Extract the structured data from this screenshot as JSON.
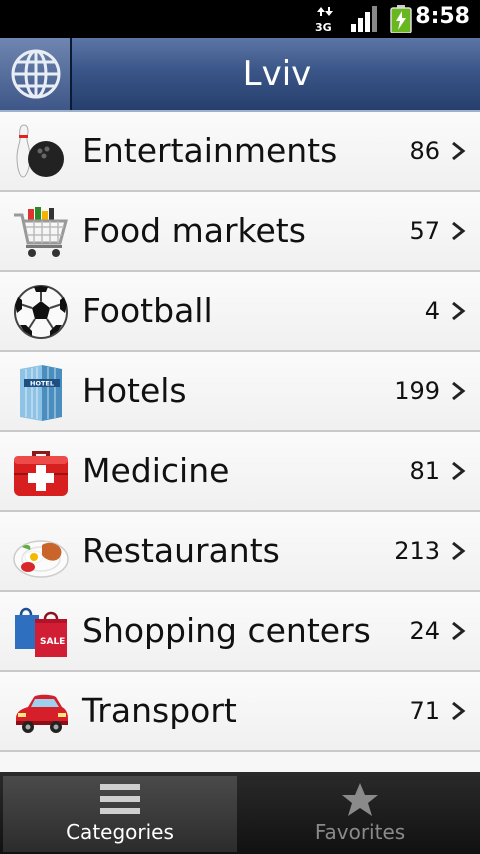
{
  "status_bar": {
    "time": "8:58",
    "network": "3G",
    "icons": [
      "data-3g-icon",
      "signal-icon",
      "battery-charging-icon"
    ]
  },
  "header": {
    "title": "Lviv",
    "globe_icon": "globe-icon"
  },
  "categories": [
    {
      "label": "Entertainments",
      "count": "86",
      "icon": "bowling-icon"
    },
    {
      "label": "Food markets",
      "count": "57",
      "icon": "shopping-cart-icon"
    },
    {
      "label": "Football",
      "count": "4",
      "icon": "soccer-ball-icon"
    },
    {
      "label": "Hotels",
      "count": "199",
      "icon": "hotel-icon"
    },
    {
      "label": "Medicine",
      "count": "81",
      "icon": "first-aid-kit-icon"
    },
    {
      "label": "Restaurants",
      "count": "213",
      "icon": "food-plate-icon"
    },
    {
      "label": "Shopping centers",
      "count": "24",
      "icon": "shopping-bags-icon"
    },
    {
      "label": "Transport",
      "count": "71",
      "icon": "car-icon"
    }
  ],
  "tabs": [
    {
      "label": "Categories",
      "icon": "list-icon",
      "selected": true
    },
    {
      "label": "Favorites",
      "icon": "star-icon",
      "selected": false
    }
  ],
  "hotel_sign": "HOTEL",
  "sale_sign": "SALE"
}
